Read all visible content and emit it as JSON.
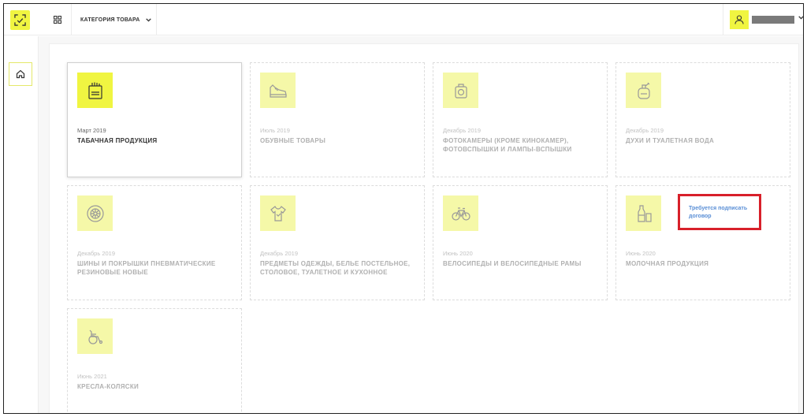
{
  "header": {
    "category_label": "КАТЕГОРИЯ ТОВАРА"
  },
  "cards": [
    {
      "date": "Март 2019",
      "title": "ТАБАЧНАЯ ПРОДУКЦИЯ",
      "icon": "tobacco-pack-icon",
      "active": true
    },
    {
      "date": "Июль 2019",
      "title": "ОБУВНЫЕ ТОВАРЫ",
      "icon": "shoe-icon"
    },
    {
      "date": "Декабрь 2019",
      "title": "ФОТОКАМЕРЫ (КРОМЕ КИНОКАМЕР), ФОТОВСПЫШКИ И ЛАМПЫ-ВСПЫШКИ",
      "icon": "camera-icon"
    },
    {
      "date": "Декабрь 2019",
      "title": "ДУХИ И ТУАЛЕТНАЯ ВОДА",
      "icon": "perfume-icon"
    },
    {
      "date": "Декабрь 2019",
      "title": "ШИНЫ И ПОКРЫШКИ ПНЕВМАТИЧЕСКИЕ РЕЗИНОВЫЕ НОВЫЕ",
      "icon": "tire-icon"
    },
    {
      "date": "Декабрь 2019",
      "title": "ПРЕДМЕТЫ ОДЕЖДЫ, БЕЛЬЕ ПОСТЕЛЬНОЕ, СТОЛОВОЕ, ТУАЛЕТНОЕ И КУХОННОЕ",
      "icon": "tshirt-icon"
    },
    {
      "date": "Июнь 2020",
      "title": "ВЕЛОСИПЕДЫ И ВЕЛОСИПЕДНЫЕ РАМЫ",
      "icon": "bicycle-icon"
    },
    {
      "date": "Июнь 2020",
      "title": "МОЛОЧНАЯ ПРОДУКЦИЯ",
      "icon": "milk-icon",
      "note": "Требуется подписать договор"
    },
    {
      "date": "Июнь 2021",
      "title": "КРЕСЛА-КОЛЯСКИ",
      "icon": "wheelchair-icon"
    }
  ],
  "colors": {
    "accent": "#f0f541",
    "accent_light": "#f5f8a8",
    "highlight_border": "#d8202a",
    "note_text": "#5a8fd6"
  }
}
